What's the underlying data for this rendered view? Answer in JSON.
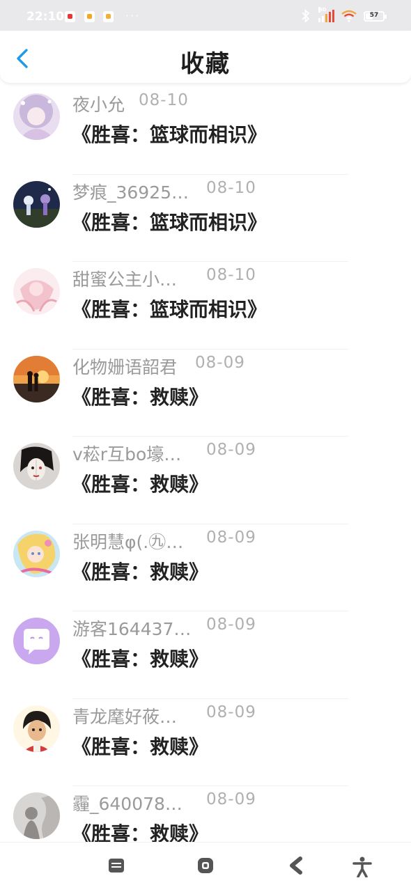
{
  "status_bar": {
    "time": "22:10",
    "more": "···",
    "network_badge": "HD",
    "battery_level": "57"
  },
  "header": {
    "title": "收藏"
  },
  "items": [
    {
      "username": "夜小允",
      "date": "08-10",
      "book": "《胜喜：篮球而相识》",
      "date_pos": "near"
    },
    {
      "username": "梦痕_36925…",
      "date": "08-10",
      "book": "《胜喜：篮球而相识》"
    },
    {
      "username": "甜蜜公主小…",
      "date": "08-10",
      "book": "《胜喜：篮球而相识》"
    },
    {
      "username": "化物姗语韶君",
      "date": "08-09",
      "book": "《胜喜：救赎》",
      "date_pos": "mid"
    },
    {
      "username": "v菘r互bo壕…",
      "date": "08-09",
      "book": "《胜喜：救赎》"
    },
    {
      "username": "张明慧φ(.㊈…",
      "date": "08-09",
      "book": "《胜喜：救赎》"
    },
    {
      "username": "游客164437…",
      "date": "08-09",
      "book": "《胜喜：救赎》"
    },
    {
      "username": "青龙麾好莜…",
      "date": "08-09",
      "book": "《胜喜：救赎》"
    },
    {
      "username": "霾_640078…",
      "date": "08-09",
      "book": "《胜喜：救赎》"
    }
  ],
  "colors": {
    "accent": "#1e9be8",
    "title": "#1e1e1e",
    "username": "#9a9a9a",
    "date": "#b0b0b0",
    "book": "#222222"
  },
  "nav": {
    "icons": [
      "menu-icon",
      "home-icon",
      "back-icon",
      "accessibility-icon"
    ]
  }
}
